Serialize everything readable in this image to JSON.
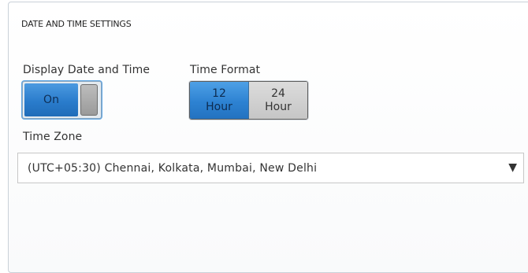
{
  "section": {
    "title": "DATE AND TIME SETTINGS"
  },
  "display_date_time": {
    "label": "Display Date and Time",
    "toggle_state_label": "On",
    "enabled": true
  },
  "time_format": {
    "label": "Time Format",
    "options": [
      {
        "line1": "12",
        "line2": "Hour",
        "selected": true
      },
      {
        "line1": "24",
        "line2": "Hour",
        "selected": false
      }
    ]
  },
  "time_zone": {
    "label": "Time Zone",
    "selected_value": "(UTC+05:30) Chennai, Kolkata, Mumbai, New Delhi",
    "dropdown_icon": "triangle-down-icon"
  },
  "colors": {
    "accent_blue": "#2d82d2",
    "toggle_knob": "#a8a8a8",
    "inactive_segment": "#d0d0d0",
    "panel_border": "#c9d1d8"
  }
}
